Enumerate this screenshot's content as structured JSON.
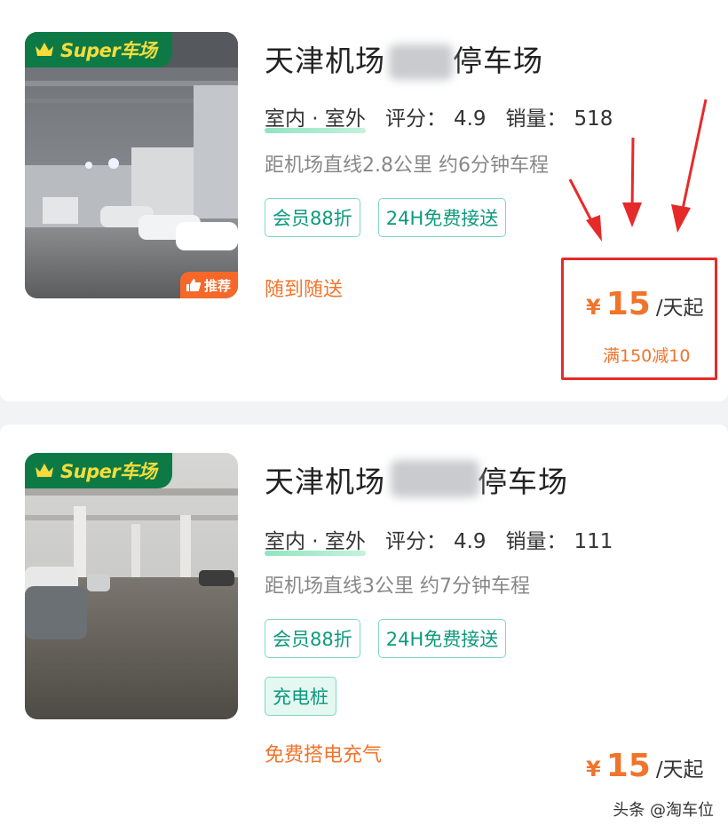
{
  "listings": [
    {
      "title_prefix": "天津机场",
      "title_suffix": "停车场",
      "super_badge": "Super车场",
      "recommend_badge": "推荐",
      "type_label": "室内 · 室外",
      "rating_label": "评分：",
      "rating": "4.9",
      "sales_label": "销量：",
      "sales": "518",
      "distance": "距机场直线2.8公里 约6分钟车程",
      "tags": [
        "会员88折",
        "24H免费接送"
      ],
      "perk": "随到随送",
      "currency": "¥",
      "price": "15",
      "price_unit": "/天起",
      "promo": "满150减10"
    },
    {
      "title_prefix": "天津机场",
      "title_suffix": "停车场",
      "super_badge": "Super车场",
      "type_label": "室内 · 室外",
      "rating_label": "评分：",
      "rating": "4.9",
      "sales_label": "销量：",
      "sales": "111",
      "distance": "距机场直线3公里 约7分钟车程",
      "tags": [
        "会员88折",
        "24H免费接送"
      ],
      "extra_tag": "充电桩",
      "perk": "免费搭电充气",
      "currency": "¥",
      "price": "15",
      "price_unit": "/天起"
    }
  ],
  "watermark": "头条 @淘车位",
  "colors": {
    "accent_orange": "#f0742c",
    "badge_green": "#0d7a45",
    "tag_teal": "#0d9a7e",
    "highlight_red": "#e62a2a"
  }
}
